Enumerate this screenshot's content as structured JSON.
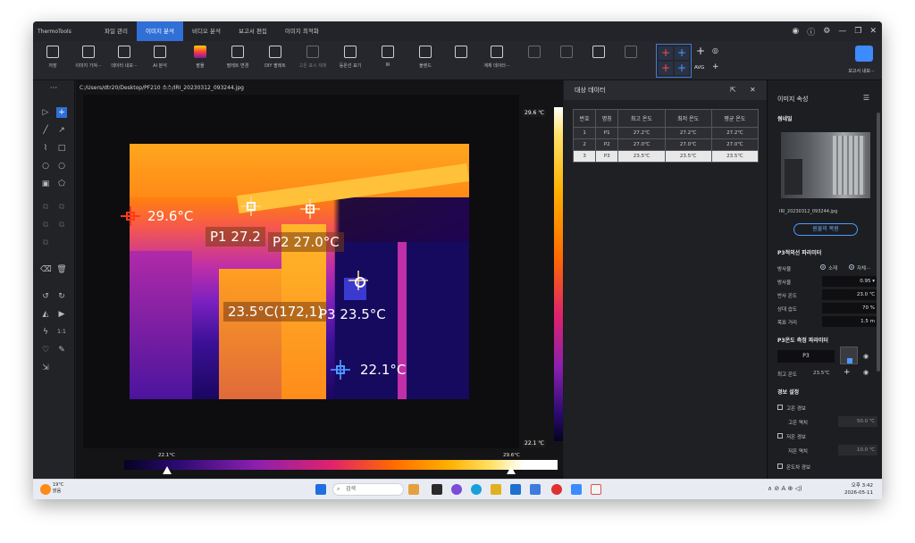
{
  "app": {
    "name": "ThermoTools",
    "menu": [
      "파일 관리",
      "이미지 분석",
      "비디오 분석",
      "보고서 편집",
      "이미지 최적화"
    ],
    "active_menu": "이미지 분석"
  },
  "toolbar": {
    "items": [
      "저장",
      "이미지 가져···",
      "데이터 내보···",
      "AI 분석",
      "팔물",
      "팔레트 변경",
      "DIY 팔레트",
      "고온 표시 제재",
      "등온선 표기",
      "IR",
      "블렌드",
      "",
      "계체 데이터···"
    ],
    "avg_label": "AVG",
    "report_label": "보고서 내보···"
  },
  "viewer": {
    "path": "C:/Users/dtr20/Desktop/PF210 소스/IRI_20230312_093244.jpg",
    "scale_max": "29.6",
    "scale_unit": "℃",
    "scale_min": "22.1",
    "scale_min_unit": "℃",
    "labels": {
      "hot": "29.6°C",
      "p1": "P1 27.2",
      "p2": "P2 27.0°C",
      "p3_coord": "23.5°C(172,1",
      "p3_coord_tail": ")",
      "p3": "P3 23.5°C",
      "cold": "22.1°C"
    },
    "bottom_min": "22.1°C",
    "bottom_max": "29.6°C",
    "a_button": "A"
  },
  "target_panel": {
    "title": "대상 데이터",
    "columns": [
      "번호",
      "명칭",
      "최고 온도",
      "최저 온도",
      "평균 온도"
    ],
    "rows": [
      [
        "1",
        "P1",
        "27.2℃",
        "27.2℃",
        "27.2℃"
      ],
      [
        "2",
        "P2",
        "27.0℃",
        "27.0℃",
        "27.0℃"
      ],
      [
        "3",
        "P3",
        "23.5℃",
        "23.5℃",
        "23.5℃"
      ]
    ],
    "selected_row": 2
  },
  "props": {
    "title": "이미지 속성",
    "thumb_section": "썸네일",
    "filename": "IRI_20230312_093244.jpg",
    "restore_btn": "원물의 복원",
    "measure_section": "P3적외선 파라미터",
    "emissivity_label": "방사율",
    "radio1": "소재",
    "radio2": "자체···",
    "rows": [
      {
        "k": "방사율",
        "v": "0.95"
      },
      {
        "k": "반사 온도",
        "v": "23.0 ℃"
      },
      {
        "k": "상대 습도",
        "v": "70 %"
      },
      {
        "k": "목표 거리",
        "v": "1.5 m"
      }
    ],
    "temp_section": "P3온도 측정 파라미터",
    "p3_name": "P3",
    "max_temp_label": "최고 온도",
    "max_temp_value": "23.5℃",
    "alarm_section": "경보 설정",
    "high_alarm": "고온 경보",
    "high_thresh_label": "고온 역치",
    "high_thresh_value": "50.0 ℃",
    "low_alarm": "저온 경보",
    "low_thresh_label": "저온 역치",
    "low_thresh_value": "10.0 ℃",
    "diff_alarm": "온도차 경보"
  },
  "taskbar": {
    "weather_temp": "19°C",
    "weather_text": "맑음",
    "search": "검색",
    "time": "오후 3:42",
    "date": "2026-05-11"
  }
}
